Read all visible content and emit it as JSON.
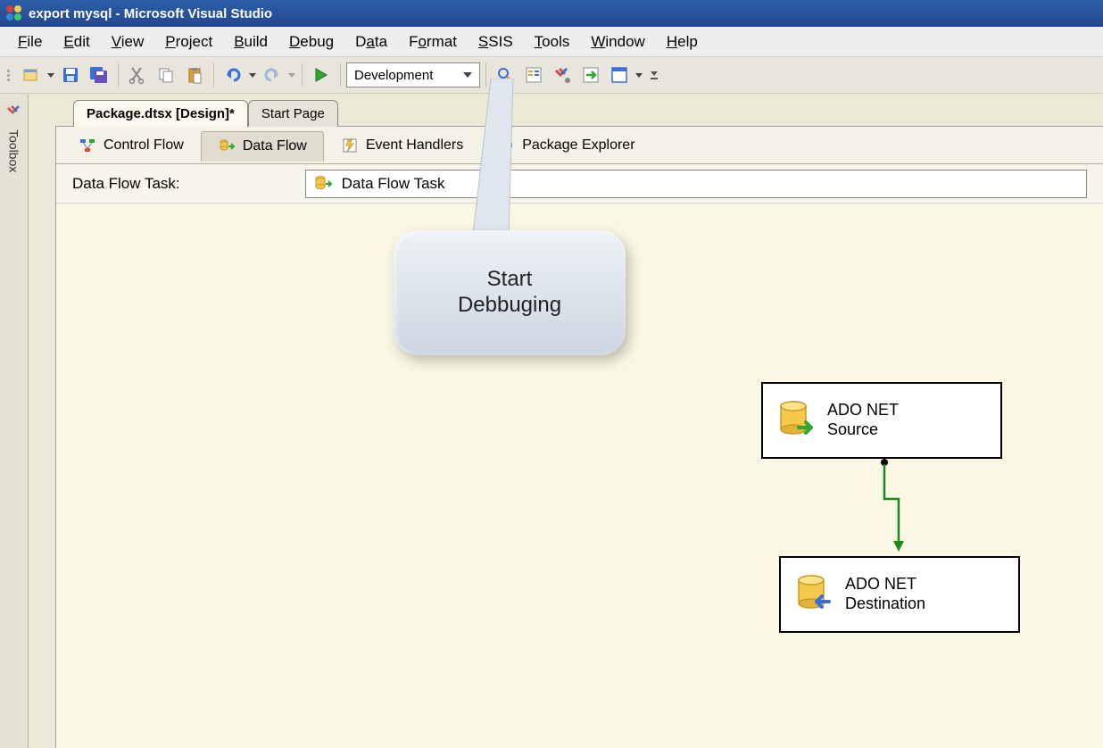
{
  "title": "export mysql - Microsoft Visual Studio",
  "menu": {
    "file": "File",
    "edit": "Edit",
    "view": "View",
    "project": "Project",
    "build": "Build",
    "debug": "Debug",
    "data": "Data",
    "format": "Format",
    "ssis": "SSIS",
    "tools": "Tools",
    "window": "Window",
    "help": "Help"
  },
  "toolbar": {
    "config_combo": "Development"
  },
  "toolbox": {
    "label": "Toolbox"
  },
  "doc_tabs": {
    "active": "Package.dtsx [Design]*",
    "other": "Start Page"
  },
  "designer_tabs": {
    "control_flow": "Control Flow",
    "data_flow": "Data Flow",
    "event_handlers": "Event Handlers",
    "package_explorer": "Package Explorer"
  },
  "task_row": {
    "label": "Data Flow Task:",
    "value": "Data Flow Task"
  },
  "callout": {
    "line1": "Start",
    "line2": "Debbuging"
  },
  "nodes": {
    "source": {
      "line1": "ADO NET",
      "line2": "Source"
    },
    "dest": {
      "line1": "ADO NET",
      "line2": "Destination"
    }
  }
}
